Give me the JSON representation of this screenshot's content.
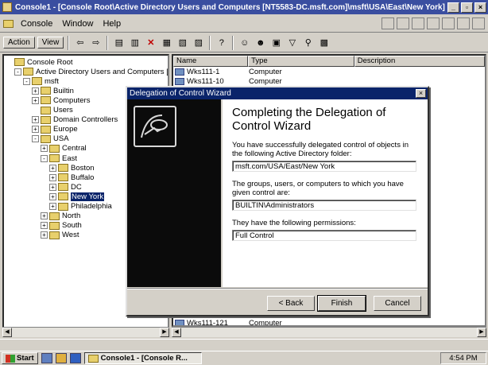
{
  "window": {
    "title": "Console1 - [Console Root\\Active Directory Users and Computers [NT5583-DC.msft.com]\\msft\\USA\\East\\New York]"
  },
  "menubar": {
    "items": [
      "Console",
      "Window",
      "Help"
    ]
  },
  "toolbar": {
    "action_label": "Action",
    "view_label": "View"
  },
  "tree": {
    "rows": [
      {
        "label": "Console Root",
        "indent": 0,
        "expand": "",
        "selected": false
      },
      {
        "label": "Active Directory Users and Computers [NT5583",
        "indent": 1,
        "expand": "-",
        "selected": false
      },
      {
        "label": "msft",
        "indent": 2,
        "expand": "-",
        "selected": false
      },
      {
        "label": "Builtin",
        "indent": 3,
        "expand": "+",
        "selected": false
      },
      {
        "label": "Computers",
        "indent": 3,
        "expand": "+",
        "selected": false
      },
      {
        "label": "Users",
        "indent": 3,
        "expand": "",
        "selected": false
      },
      {
        "label": "Domain Controllers",
        "indent": 3,
        "expand": "+",
        "selected": false
      },
      {
        "label": "Europe",
        "indent": 3,
        "expand": "+",
        "selected": false
      },
      {
        "label": "USA",
        "indent": 3,
        "expand": "-",
        "selected": false
      },
      {
        "label": "Central",
        "indent": 4,
        "expand": "+",
        "selected": false
      },
      {
        "label": "East",
        "indent": 4,
        "expand": "-",
        "selected": false
      },
      {
        "label": "Boston",
        "indent": 5,
        "expand": "+",
        "selected": false
      },
      {
        "label": "Buffalo",
        "indent": 5,
        "expand": "+",
        "selected": false
      },
      {
        "label": "DC",
        "indent": 5,
        "expand": "+",
        "selected": false
      },
      {
        "label": "New York",
        "indent": 5,
        "expand": "+",
        "selected": true
      },
      {
        "label": "Philadelphia",
        "indent": 5,
        "expand": "+",
        "selected": false
      },
      {
        "label": "North",
        "indent": 4,
        "expand": "+",
        "selected": false
      },
      {
        "label": "South",
        "indent": 4,
        "expand": "+",
        "selected": false
      },
      {
        "label": "West",
        "indent": 4,
        "expand": "+",
        "selected": false
      }
    ]
  },
  "list": {
    "columns": [
      "Name",
      "Type",
      "Description"
    ],
    "rows": [
      {
        "name": "Wks111-1",
        "type": "Computer"
      },
      {
        "name": "Wks111-10",
        "type": "Computer"
      }
    ],
    "bottom_row": {
      "name": "Wks111-121",
      "type": "Computer"
    }
  },
  "dialog": {
    "title": "Delegation of Control Wizard",
    "heading": "Completing the Delegation of Control Wizard",
    "text1": "You have successfully delegated control of objects in the following Active Directory folder:",
    "folder": "msft.com/USA/East/New York",
    "text2": "The groups, users, or computers to which you have given control are:",
    "principals": "BUILTIN\\Administrators",
    "text3": "They have the following permissions:",
    "permissions": "Full Control",
    "back_label": "< Back",
    "finish_label": "Finish",
    "cancel_label": "Cancel",
    "close_label": "×"
  },
  "taskbar": {
    "start_label": "Start",
    "task_label": "Console1 - [Console R...",
    "clock": "4:54 PM"
  }
}
